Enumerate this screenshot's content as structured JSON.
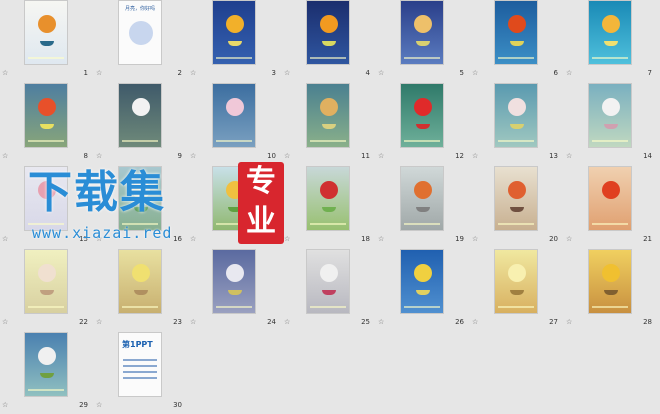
{
  "slides": [
    {
      "n": "1",
      "bg": "linear-gradient(#f6f6f2,#dfe8f0)",
      "moon": "#e8902c",
      "boat": "#2a6a8a",
      "type": "cover"
    },
    {
      "n": "2",
      "bg": "#fbfbfb",
      "moon": "#c8d6ee",
      "boat": "",
      "type": "title"
    },
    {
      "n": "3",
      "bg": "linear-gradient(#1f3f8e,#3561b0)",
      "moon": "#f2b02a",
      "boat": "#e9d96a",
      "type": "moon"
    },
    {
      "n": "4",
      "bg": "linear-gradient(#1b2e6e,#2f56a0)",
      "moon": "#f29a20",
      "boat": "#d8d860",
      "type": "moon"
    },
    {
      "n": "5",
      "bg": "linear-gradient(#2a3f8a,#5b7cc0)",
      "moon": "#eec06a",
      "boat": "#d8d070",
      "type": "moon"
    },
    {
      "n": "6",
      "bg": "linear-gradient(#1d5d9e,#3c8fc6)",
      "moon": "#e04a1c",
      "boat": "#e0d25a",
      "type": "moon"
    },
    {
      "n": "7",
      "bg": "linear-gradient(#1a8ab6,#4fc0dc)",
      "moon": "#f3b63a",
      "boat": "#f0e070",
      "type": "moon"
    },
    {
      "n": "8",
      "bg": "linear-gradient(#4e7ea0,#88a57a)",
      "moon": "#e8502a",
      "boat": "#e8e060",
      "type": "moon"
    },
    {
      "n": "9",
      "bg": "linear-gradient(#3f5a6a,#6f8a7a)",
      "moon": "#f2f2f2",
      "boat": "",
      "type": "moon"
    },
    {
      "n": "10",
      "bg": "linear-gradient(#3c6ea0,#7aa0c0)",
      "moon": "#f0c8d8",
      "boat": "",
      "type": "moon"
    },
    {
      "n": "11",
      "bg": "linear-gradient(#4a8090,#8ab08a)",
      "moon": "#e0b060",
      "boat": "#d8d080",
      "type": "moon"
    },
    {
      "n": "12",
      "bg": "linear-gradient(#2f7a6a,#6fb09a)",
      "moon": "#e02a2a",
      "boat": "#d03030",
      "type": "moon"
    },
    {
      "n": "13",
      "bg": "linear-gradient(#5a9ab0,#a0c8c0)",
      "moon": "#f0e0e0",
      "boat": "#d8d070",
      "type": "moon"
    },
    {
      "n": "14",
      "bg": "linear-gradient(#7ab0c0,#c0d8c0)",
      "moon": "#f2f2f2",
      "boat": "#d0a0b0",
      "type": "moon"
    },
    {
      "n": "15",
      "bg": "linear-gradient(#e8e8f0,#d8d8e8)",
      "moon": "#e8a0b0",
      "boat": "",
      "type": "moon"
    },
    {
      "n": "16",
      "bg": "linear-gradient(#a8c8d0,#88b090)",
      "moon": "#e0e0c0",
      "boat": "#60a060",
      "type": "moon"
    },
    {
      "n": "17",
      "bg": "linear-gradient(#c8e0e8,#90b870)",
      "moon": "#f0c040",
      "boat": "#60a040",
      "type": "moon"
    },
    {
      "n": "18",
      "bg": "linear-gradient(#c8d8d8,#98c070)",
      "moon": "#d03030",
      "boat": "#70b050",
      "type": "moon"
    },
    {
      "n": "19",
      "bg": "linear-gradient(#d0d8d8,#a0a8a8)",
      "moon": "#e07030",
      "boat": "#808080",
      "type": "moon"
    },
    {
      "n": "20",
      "bg": "linear-gradient(#e8e0d0,#c8b090)",
      "moon": "#e06030",
      "boat": "#705040",
      "type": "moon"
    },
    {
      "n": "21",
      "bg": "linear-gradient(#f0d0b0,#e0a070)",
      "moon": "#e04020",
      "boat": "",
      "type": "moon"
    },
    {
      "n": "22",
      "bg": "linear-gradient(#f0f0c0,#d8d0a0)",
      "moon": "#f0e0d0",
      "boat": "#c0a080",
      "type": "moon"
    },
    {
      "n": "23",
      "bg": "linear-gradient(#e8e0a0,#c8b070)",
      "moon": "#f0e070",
      "boat": "#b09060",
      "type": "moon"
    },
    {
      "n": "24",
      "bg": "linear-gradient(#5a6aa0,#9aa0c0)",
      "moon": "#e8e8f0",
      "boat": "#d0c060",
      "type": "moon"
    },
    {
      "n": "25",
      "bg": "linear-gradient(#e0e0e0,#b8b8c0)",
      "moon": "#f0f0f0",
      "boat": "#c04060",
      "type": "moon"
    },
    {
      "n": "26",
      "bg": "linear-gradient(#2060b0,#5090d0)",
      "moon": "#f0d040",
      "boat": "#e0d060",
      "type": "moon"
    },
    {
      "n": "27",
      "bg": "linear-gradient(#f0e8a0,#d8b060)",
      "moon": "#f8f0b0",
      "boat": "#a08040",
      "type": "moon"
    },
    {
      "n": "28",
      "bg": "linear-gradient(#f0d060,#c89040)",
      "moon": "#f0c030",
      "boat": "#806030",
      "type": "moon"
    },
    {
      "n": "29",
      "bg": "linear-gradient(#4a80b0,#90c0c0)",
      "moon": "#f0f0f0",
      "boat": "#70a040",
      "type": "moon"
    },
    {
      "n": "30",
      "bg": "#fbfbfb",
      "moon": "",
      "boat": "",
      "type": "end"
    }
  ],
  "watermark": {
    "title": "下载集",
    "seal": "专业",
    "url": "www.xiazai.red"
  },
  "slide2_title": "月亮，你好吗",
  "slide30_logo": "第1PPT"
}
